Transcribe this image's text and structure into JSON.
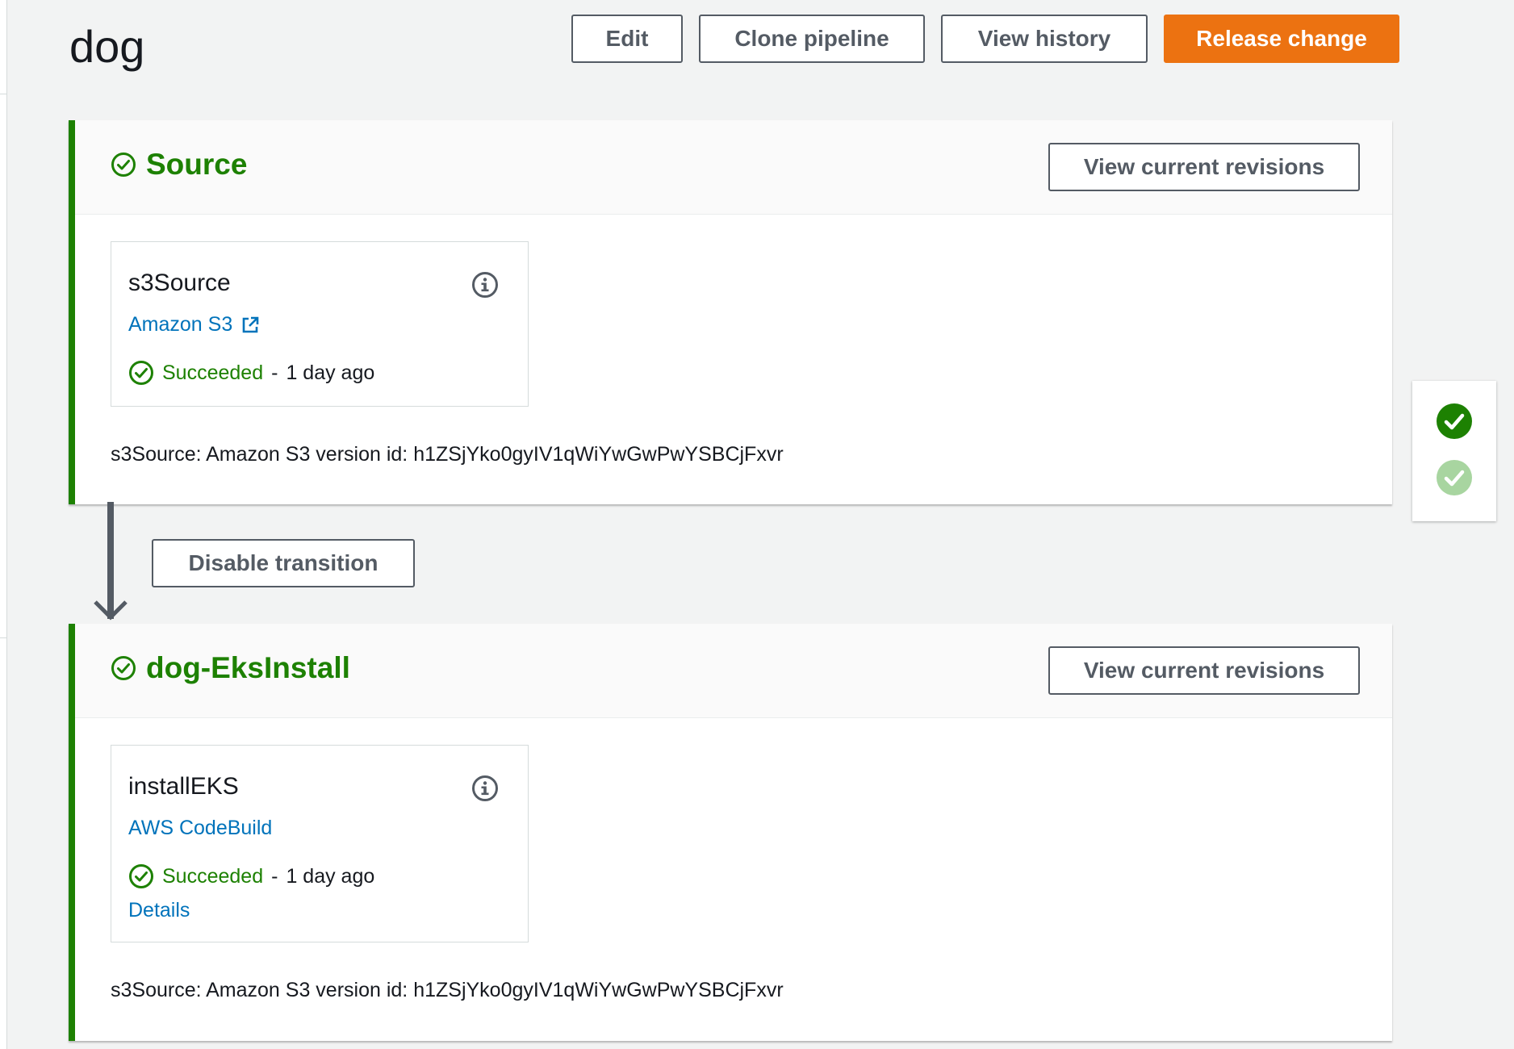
{
  "pipeline": {
    "name": "dog"
  },
  "header_actions": {
    "edit_label": "Edit",
    "clone_label": "Clone pipeline",
    "history_label": "View history",
    "release_label": "Release change"
  },
  "colors": {
    "success": "#1d8102",
    "link": "#0073bb",
    "primary": "#ec7211",
    "border": "#545b64",
    "background": "#f2f3f3"
  },
  "stages": [
    {
      "name": "Source",
      "status_icon": "check-circle-icon",
      "view_revisions_label": "View current revisions",
      "action": {
        "name": "s3Source",
        "provider": "Amazon S3",
        "provider_icon": "external-link-icon",
        "status": "Succeeded",
        "separator": "-",
        "time_ago": "1 day ago"
      },
      "revision_summary": "s3Source: Amazon S3 version id: h1ZSjYko0gyIV1qWiYwGwPwYSBCjFxvr"
    },
    {
      "name": "dog-EksInstall",
      "status_icon": "check-circle-icon",
      "view_revisions_label": "View current revisions",
      "action": {
        "name": "installEKS",
        "provider": "AWS CodeBuild",
        "status": "Succeeded",
        "separator": "-",
        "time_ago": "1 day ago",
        "details_label": "Details"
      },
      "revision_summary": "s3Source: Amazon S3 version id: h1ZSjYko0gyIV1qWiYwGwPwYSBCjFxvr"
    }
  ],
  "transition": {
    "button_label": "Disable transition",
    "arrow_icon": "arrow-down-icon"
  },
  "stage_navigator": {
    "items": [
      {
        "icon": "check-filled-icon",
        "state": "active"
      },
      {
        "icon": "check-filled-icon",
        "state": "inactive"
      }
    ]
  }
}
